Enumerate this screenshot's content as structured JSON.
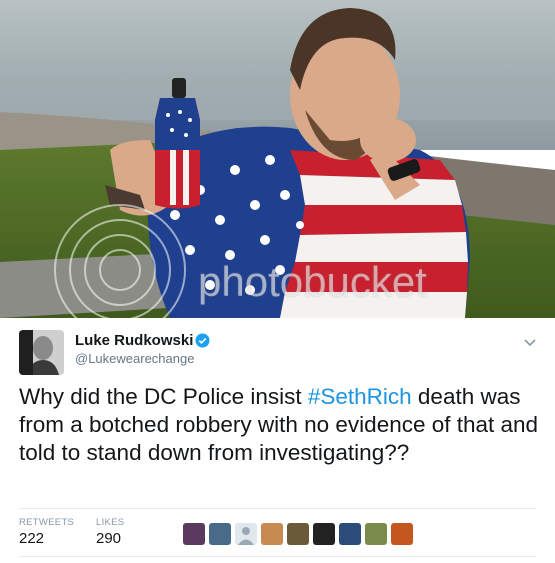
{
  "photo": {
    "watermark": "photobucket",
    "description_icon": "photo-icon"
  },
  "tweet": {
    "author_name": "Luke Rudkowski",
    "author_handle": "@Lukewearechange",
    "text_before": "Why did the DC Police insist ",
    "hashtag": "#SethRich",
    "text_after": " death was from a botched robbery with no evidence of that and told to stand down from investigating??",
    "retweets_label": "RETWEETS",
    "retweets_count": "222",
    "likes_label": "LIKES",
    "likes_count": "290",
    "verified_icon": "verified-badge-icon",
    "menu_icon": "chevron-down-icon",
    "colors": {
      "hashtag": "#1b95e0",
      "verified": "#1da1f2",
      "text": "#14171a",
      "secondary": "#657786"
    }
  }
}
